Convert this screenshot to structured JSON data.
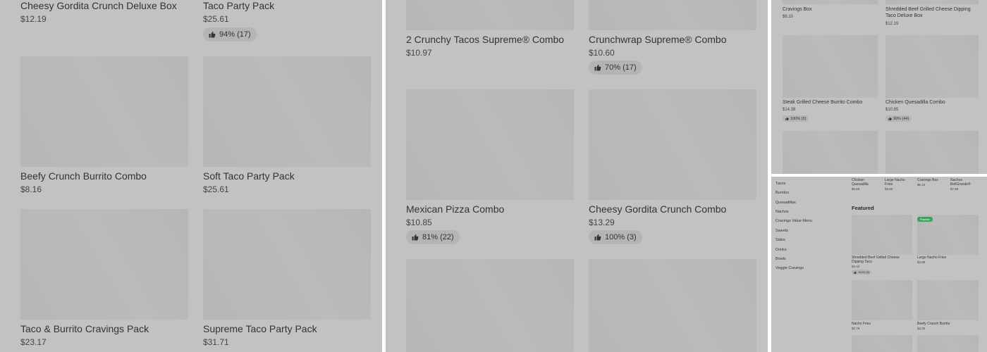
{
  "panel1": {
    "items": [
      {
        "name": "Cheesy Gordita Crunch Deluxe Box",
        "price": "$12.19"
      },
      {
        "name": "Taco Party Pack",
        "price": "$25.61",
        "rating": "94% (17)"
      },
      {
        "name": "Beefy Crunch Burrito Combo",
        "price": "$8.16"
      },
      {
        "name": "Soft Taco Party Pack",
        "price": "$25.61"
      },
      {
        "name": "Taco & Burrito Cravings Pack",
        "price": "$23.17"
      },
      {
        "name": "Supreme Taco Party Pack",
        "price": "$31.71"
      }
    ]
  },
  "panel2": {
    "items": [
      {
        "name": "2 Crunchy Tacos Supreme® Combo",
        "price": "$10.97"
      },
      {
        "name": "Crunchwrap Supreme® Combo",
        "price": "$10.60",
        "rating": "70% (17)"
      },
      {
        "name": "Mexican Pizza Combo",
        "price": "$10.85",
        "rating": "81% (22)"
      },
      {
        "name": "Cheesy Gordita Crunch Combo",
        "price": "$13.29",
        "rating": "100% (3)"
      }
    ]
  },
  "panel3": {
    "items": [
      {
        "name": "Cravings Box",
        "price": "$6.10"
      },
      {
        "name": "Shredded Beef Grilled Cheese Dipping Taco Deluxe Box",
        "price": "$12.19"
      },
      {
        "name": "Steak Grilled Cheese Burrito Combo",
        "price": "$14.38",
        "rating": "100% (3)"
      },
      {
        "name": "Chicken Quesadilla Combo",
        "price": "$10.85",
        "rating": "90% (44)"
      }
    ]
  },
  "panel4": {
    "nav": [
      "Tacos",
      "Burritos",
      "Quesadillas",
      "Nachos",
      "Cravings Value Menu",
      "Sweets",
      "Sides",
      "Drinks",
      "Bowls",
      "Veggie Cravings"
    ],
    "top_items": [
      {
        "name": "Chicken Quesadilla",
        "price": "$6.59"
      },
      {
        "name": "Large Nacho Fries",
        "price": "$3.89"
      },
      {
        "name": "Cravings Box",
        "price": "$6.10"
      },
      {
        "name": "Nachos BellGrande®",
        "price": "$7.60"
      }
    ],
    "featured_heading": "Featured",
    "badge": "Popular",
    "featured": [
      {
        "name": "Shredded Beef Grilled Cheese Dipping Taco",
        "price": "$4.42",
        "rating": "100% (5)"
      },
      {
        "name": "Large Nacho Fries",
        "price": "$3.89"
      },
      {
        "name": "Nacho Fries",
        "price": "$2.79"
      },
      {
        "name": "Beefy Crunch Burrito",
        "price": "$3.26"
      }
    ]
  },
  "icons": {
    "rating": "thumbs-up-icon"
  },
  "colors": {
    "overlay": "#c2c2c2",
    "placeholder": "#b6b6b6",
    "badge": "#3fa05b"
  }
}
